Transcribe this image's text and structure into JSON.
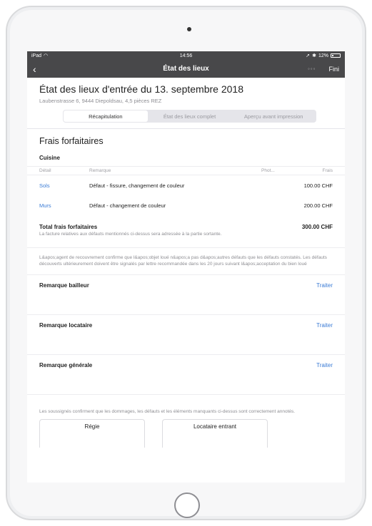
{
  "statusbar": {
    "device": "iPad",
    "time": "14:56",
    "battery": "12%"
  },
  "navbar": {
    "back_icon": "chevron-left-icon",
    "title": "État des lieux",
    "more": "◦◦◦",
    "done_label": "Fini"
  },
  "header": {
    "title": "État des lieux d'entrée du 13. septembre 2018",
    "address": "Laubenstrasse 6, 9444 Diepoldsau, 4,5 pièces REZ"
  },
  "tabs": [
    "Récapitulation",
    "État des lieux complet",
    "Aperçu avant impression"
  ],
  "section": {
    "title": "Frais forfaitaires",
    "room": "Cuisine",
    "columns": {
      "detail": "Détail",
      "remark": "Remarque",
      "photo": "Phot...",
      "fee": "Frais"
    },
    "rows": [
      {
        "detail": "Sols",
        "remark": "Défaut - fissure, changement de couleur",
        "fee": "100.00 CHF"
      },
      {
        "detail": "Murs",
        "remark": "Défaut - changement de couleur",
        "fee": "200.00 CHF"
      }
    ],
    "total_label": "Total frais forfaitaires",
    "total_value": "300.00 CHF",
    "total_note": "La facture relatives aux défauts mentionnés ci-dessus sera adressée à la partie sortante."
  },
  "legal_text": "L&apos;agent de recouvrement confirme que l&apos;objet loué n&apos;a pas d&apos;autres défauts que les défauts constatés. Les défauts découverts ultérieurement doivent être signalés par lettre recommandée dans les 20 jours suivant l&apos;acceptation du bien loué",
  "remarks": [
    {
      "label": "Remarque bailleur",
      "action": "Traiter"
    },
    {
      "label": "Remarque locataire",
      "action": "Traiter"
    },
    {
      "label": "Remarque générale",
      "action": "Traiter"
    }
  ],
  "signature_note": "Les soussignés confirment que les dommages, les défauts et les éléments manquants ci-dessus sont correctement annotés.",
  "signatures": [
    "Régie",
    "Locataire entrant"
  ]
}
